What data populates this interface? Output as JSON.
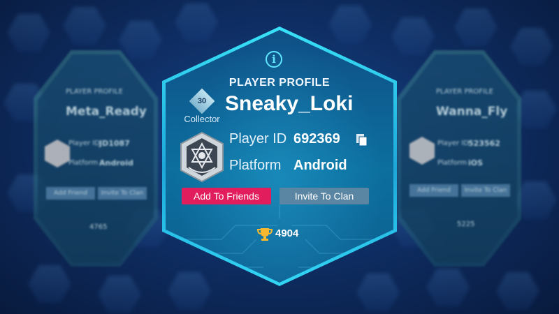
{
  "main_card": {
    "section_title": "PLAYER PROFILE",
    "player_name": "Sneaky_Loki",
    "level": "30",
    "rank_title": "Collector",
    "player_id_label": "Player ID",
    "player_id": "692369",
    "platform_label": "Platform",
    "platform": "Android",
    "add_friends_label": "Add To Friends",
    "invite_clan_label": "Invite To Clan",
    "trophies": "4904"
  },
  "left_card": {
    "section_title": "PLAYER PROFILE",
    "player_name": "Meta_Ready",
    "player_id_label": "Player ID",
    "player_id": "JD1087",
    "platform_label": "Platform",
    "platform": "Android",
    "add_friends_label": "Add Friend",
    "invite_clan_label": "Invite To Clan",
    "trophies": "4765"
  },
  "right_card": {
    "section_title": "PLAYER PROFILE",
    "player_name": "Wanna_Fly",
    "player_id_label": "Player ID",
    "player_id": "523562",
    "platform_label": "Platform",
    "platform": "iOS",
    "add_friends_label": "Add Friend",
    "invite_clan_label": "Invite To Clan",
    "trophies": "5225"
  },
  "icons": {
    "info": "info-icon",
    "copy": "copy-icon",
    "trophy": "trophy-icon",
    "avatar": "clan-emblem-icon"
  },
  "colors": {
    "accent_cyan": "#39e2f8",
    "friends_button": "#e11d5e",
    "clan_button": "#5a86a4",
    "trophy_gold": "#f5b82e"
  }
}
